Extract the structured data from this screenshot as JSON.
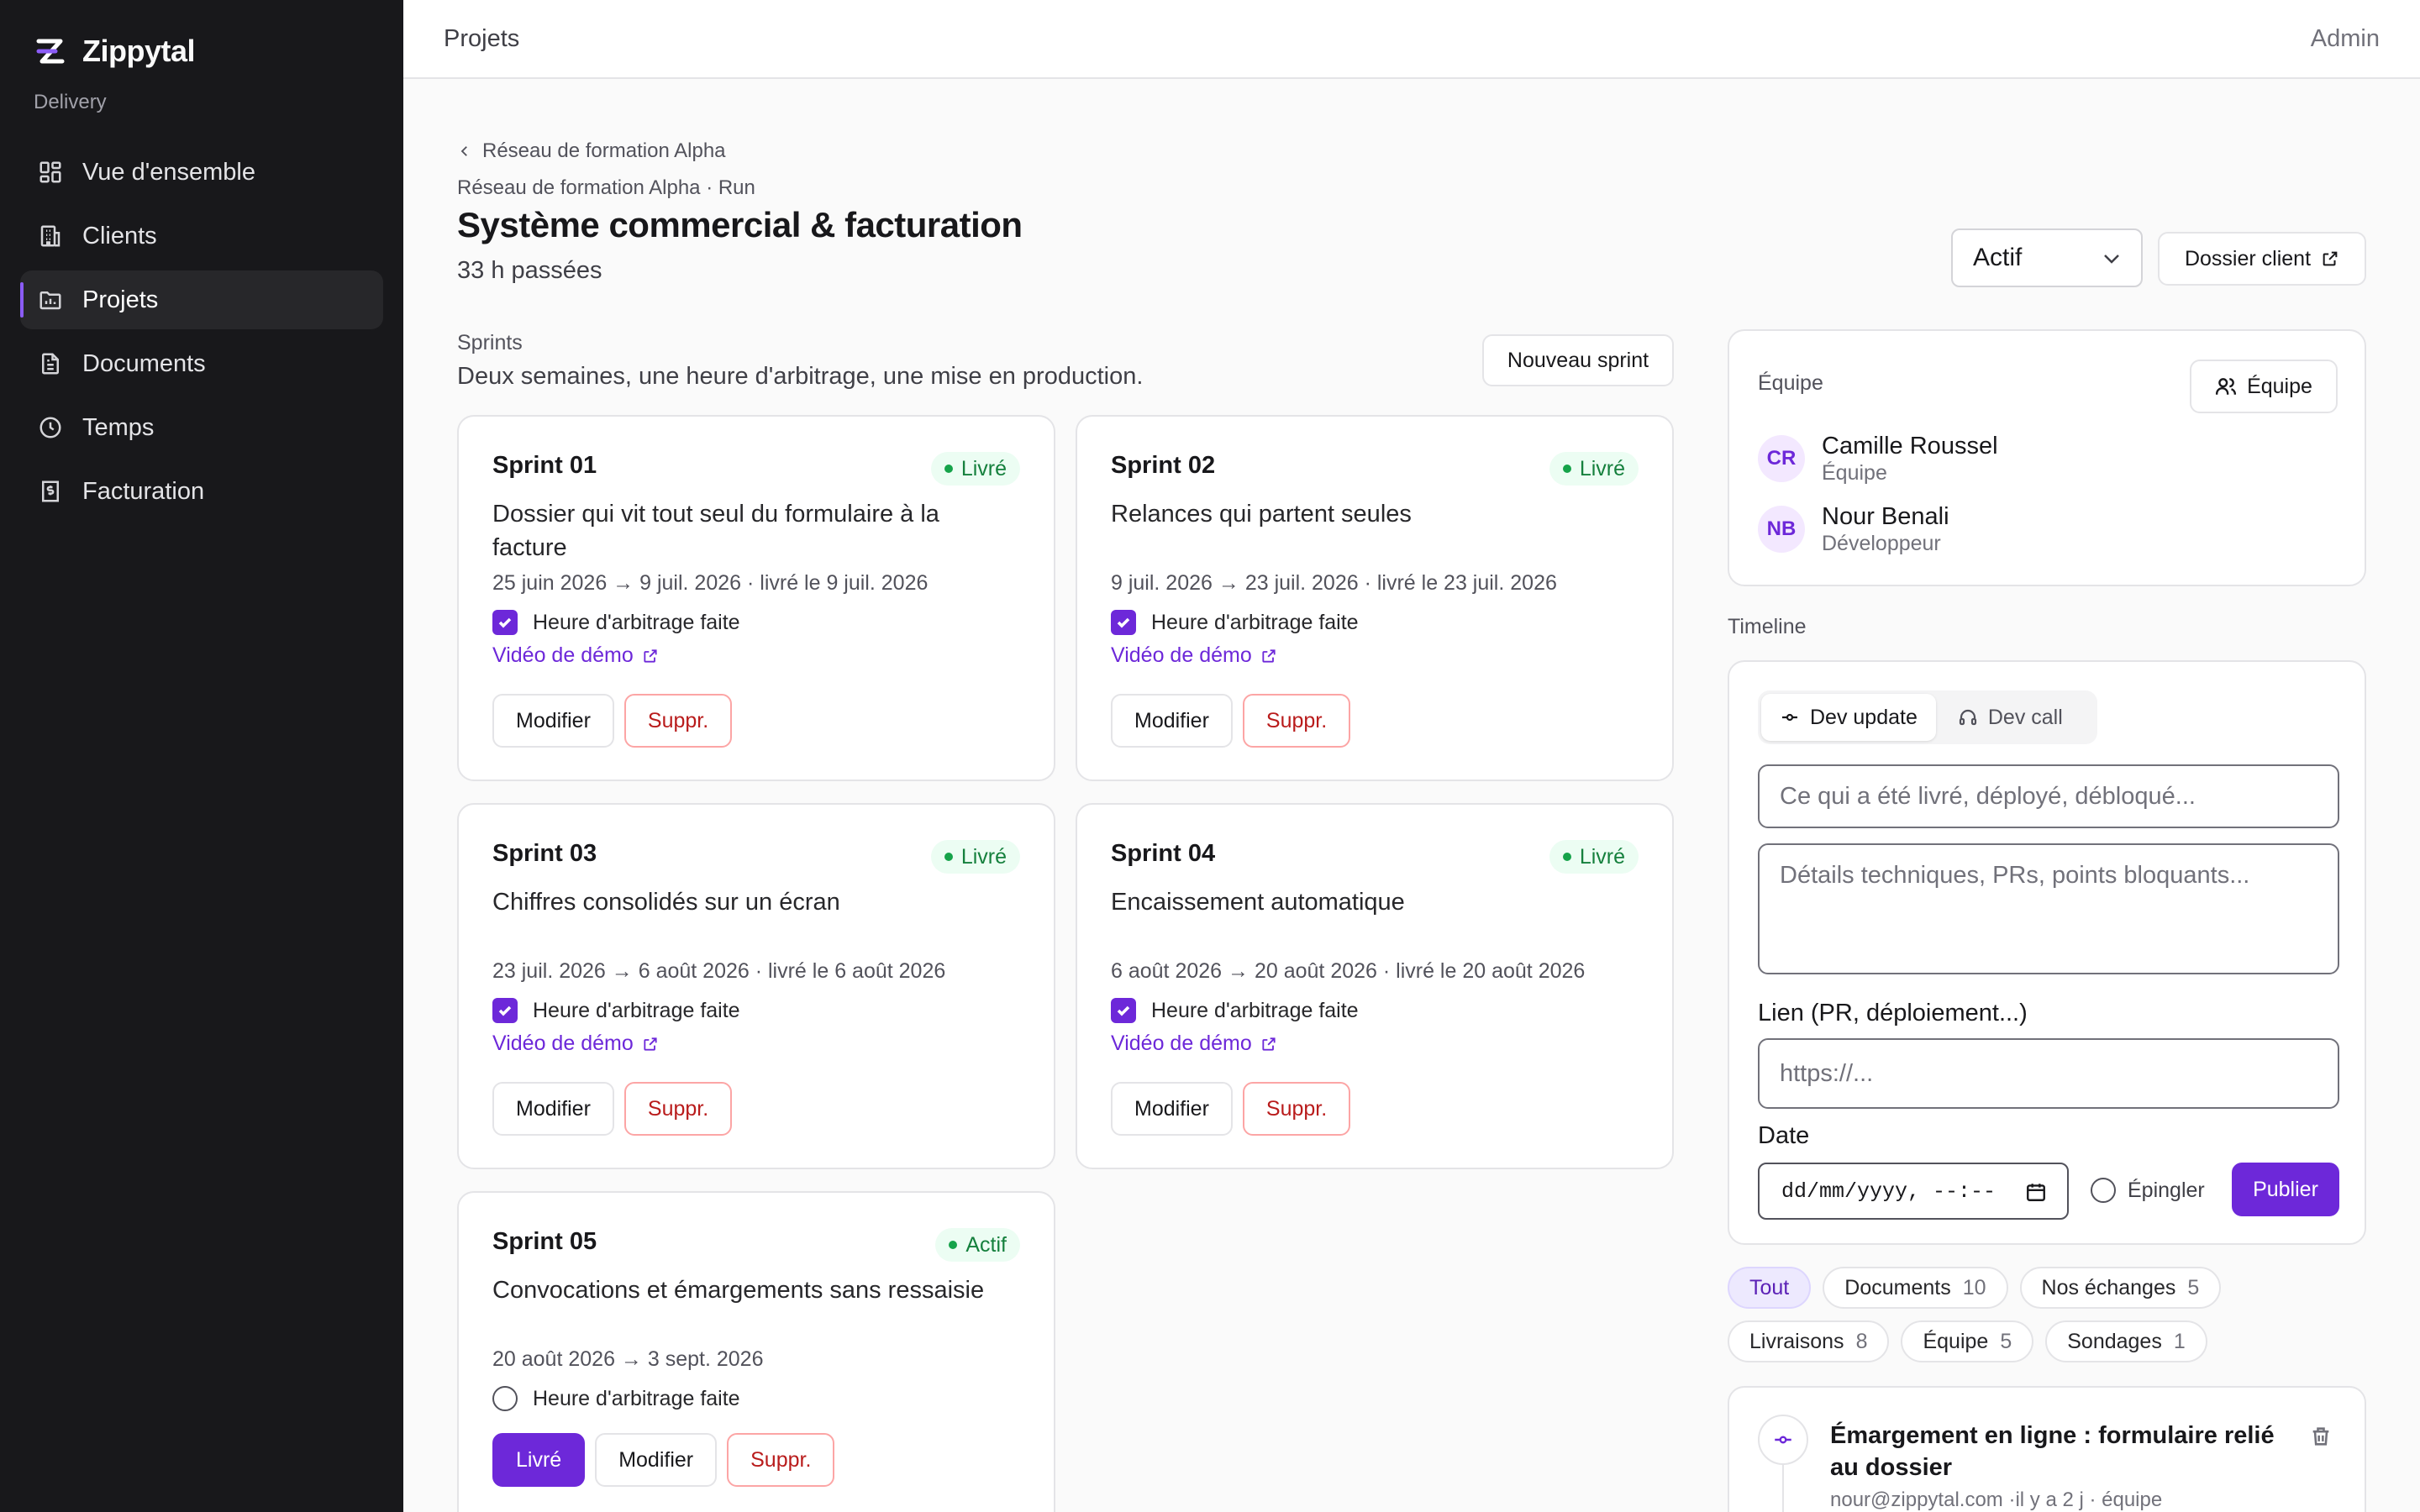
{
  "app": {
    "name": "Zippytal",
    "subtitle": "Delivery",
    "accent": "#6d28d9"
  },
  "sidebar": {
    "items": [
      {
        "label": "Vue d'ensemble",
        "icon": "dashboard-icon"
      },
      {
        "label": "Clients",
        "icon": "building-icon"
      },
      {
        "label": "Projets",
        "icon": "folder-chart-icon",
        "active": true
      },
      {
        "label": "Documents",
        "icon": "document-icon"
      },
      {
        "label": "Temps",
        "icon": "clock-icon"
      },
      {
        "label": "Facturation",
        "icon": "receipt-icon"
      }
    ]
  },
  "topbar": {
    "section": "Projets",
    "user": "Admin"
  },
  "header": {
    "back_label": "Réseau de formation Alpha",
    "meta": "Réseau de formation Alpha · Run",
    "title": "Système commercial & facturation",
    "hours": "33 h passées",
    "status_value": "Actif",
    "dossier_label": "Dossier client"
  },
  "sprints": {
    "label": "Sprints",
    "description": "Deux semaines, une heure d'arbitrage, une mise en production.",
    "new_label": "Nouveau sprint",
    "check_label": "Heure d'arbitrage faite",
    "demo_label": "Vidéo de démo",
    "edit_label": "Modifier",
    "delete_label": "Suppr.",
    "delivered_label": "Livré",
    "items": [
      {
        "title": "Sprint 01",
        "status": "Livré",
        "desc": "Dossier qui vit tout seul du formulaire à la facture",
        "dates": "25 juin 2026 → 9 juil. 2026 · livré le 9 juil. 2026",
        "checked": true
      },
      {
        "title": "Sprint 02",
        "status": "Livré",
        "desc": "Relances qui partent seules",
        "dates": "9 juil. 2026 → 23 juil. 2026 · livré le 23 juil. 2026",
        "checked": true
      },
      {
        "title": "Sprint 03",
        "status": "Livré",
        "desc": "Chiffres consolidés sur un écran",
        "dates": "23 juil. 2026 → 6 août 2026 · livré le 6 août 2026",
        "checked": true
      },
      {
        "title": "Sprint 04",
        "status": "Livré",
        "desc": "Encaissement automatique",
        "dates": "6 août 2026 → 20 août 2026 · livré le 20 août 2026",
        "checked": true
      },
      {
        "title": "Sprint 05",
        "status": "Actif",
        "desc": "Convocations et émargements sans ressaisie",
        "dates": "20 août 2026 → 3 sept. 2026",
        "checked": false
      }
    ]
  },
  "team": {
    "label": "Équipe",
    "button_label": "Équipe",
    "members": [
      {
        "initials": "CR",
        "name": "Camille Roussel",
        "role": "Équipe"
      },
      {
        "initials": "NB",
        "name": "Nour Benali",
        "role": "Développeur"
      }
    ]
  },
  "timeline": {
    "label": "Timeline",
    "tabs": [
      {
        "label": "Dev update",
        "icon": "commit-icon"
      },
      {
        "label": "Dev call",
        "icon": "headset-icon"
      }
    ],
    "summary_placeholder": "Ce qui a été livré, déployé, débloqué...",
    "details_placeholder": "Détails techniques, PRs, points bloquants...",
    "link_label": "Lien (PR, déploiement...)",
    "link_placeholder": "https://...",
    "date_label": "Date",
    "date_value": "dd/mm/yyyy, --:--",
    "pin_label": "Épingler",
    "publish_label": "Publier",
    "filters": [
      {
        "label": "Tout",
        "count": ""
      },
      {
        "label": "Documents",
        "count": "10"
      },
      {
        "label": "Nos échanges",
        "count": "5"
      },
      {
        "label": "Livraisons",
        "count": "8"
      },
      {
        "label": "Équipe",
        "count": "5"
      },
      {
        "label": "Sondages",
        "count": "1"
      }
    ],
    "entry": {
      "title": "Émargement en ligne : formulaire relié au dossier",
      "meta": "nour@zippytal.com ·il y a 2 j · équipe"
    }
  }
}
